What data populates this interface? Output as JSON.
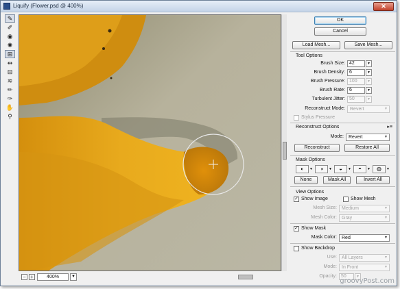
{
  "window": {
    "title": "Liquify (Flower.psd @ 400%)"
  },
  "status": {
    "zoom": "400%"
  },
  "toolbox": {
    "tools": [
      "forward-warp",
      "reconstruct",
      "twirl",
      "pucker",
      "bloat",
      "push-left",
      "mirror",
      "turbulence",
      "freeze-mask",
      "thaw-mask",
      "hand",
      "zoom"
    ]
  },
  "buttons": {
    "ok": "OK",
    "cancel": "Cancel",
    "load_mesh": "Load Mesh...",
    "save_mesh": "Save Mesh..."
  },
  "tool_options": {
    "title": "Tool Options",
    "brush_size": {
      "label": "Brush Size:",
      "value": "42"
    },
    "brush_density": {
      "label": "Brush Density:",
      "value": "6"
    },
    "brush_pressure": {
      "label": "Brush Pressure:",
      "value": "100"
    },
    "brush_rate": {
      "label": "Brush Rate:",
      "value": "6"
    },
    "turbulent_jitter": {
      "label": "Turbulent Jitter:",
      "value": "50"
    },
    "reconstruct_mode": {
      "label": "Reconstruct Mode:",
      "value": "Revert"
    },
    "stylus_pressure": "Stylus Pressure"
  },
  "reconstruct_options": {
    "title": "Reconstruct Options",
    "mode_label": "Mode:",
    "mode_value": "Revert",
    "reconstruct": "Reconstruct",
    "restore_all": "Restore All"
  },
  "mask_options": {
    "title": "Mask Options",
    "none": "None",
    "mask_all": "Mask All",
    "invert_all": "Invert All"
  },
  "view_options": {
    "title": "View Options",
    "show_image": "Show Image",
    "show_mesh": "Show Mesh",
    "mesh_size": {
      "label": "Mesh Size:",
      "value": "Medium"
    },
    "mesh_color": {
      "label": "Mesh Color:",
      "value": "Gray"
    },
    "show_mask": "Show Mask",
    "mask_color": {
      "label": "Mask Color:",
      "value": "Red"
    },
    "show_backdrop": "Show Backdrop",
    "use": {
      "label": "Use:",
      "value": "All Layers"
    },
    "mode": {
      "label": "Mode:",
      "value": "In Front"
    },
    "opacity": {
      "label": "Opacity:",
      "value": "50"
    }
  },
  "watermark": "groovyPost.com",
  "colors": {
    "petal": "#e2a41a",
    "background": "#a8a18b",
    "accent": "#3c7fb1"
  }
}
